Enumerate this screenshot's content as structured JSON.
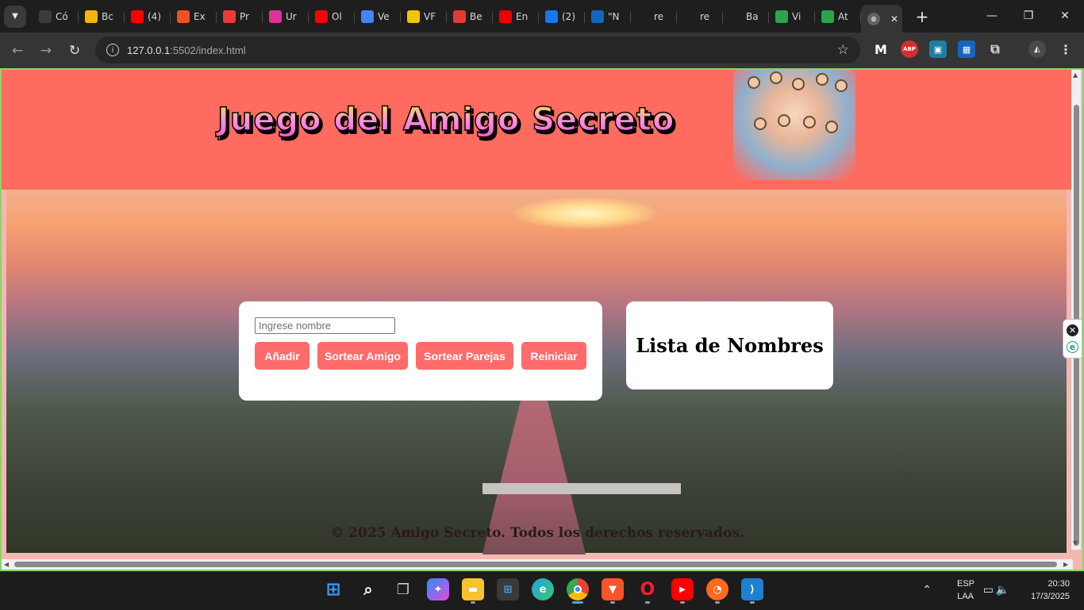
{
  "browser": {
    "tabs": [
      {
        "label": "Có",
        "icon": "document-icon",
        "color": "#3b3b3b"
      },
      {
        "label": "Bc",
        "icon": "drive-icon",
        "color": "#f7b500"
      },
      {
        "label": "(4)",
        "icon": "youtube-icon",
        "color": "#ff0000"
      },
      {
        "label": "Ex",
        "icon": "microsoft-icon",
        "color": "#f25022"
      },
      {
        "label": "Pr",
        "icon": "vivaldi-icon",
        "color": "#ef3939"
      },
      {
        "label": "Ur",
        "icon": "ef-icon",
        "color": "#e0309b"
      },
      {
        "label": "Ol",
        "icon": "youtube-icon",
        "color": "#ff0000"
      },
      {
        "label": "Ve",
        "icon": "google-icon",
        "color": "#4285f4"
      },
      {
        "label": "VF",
        "icon": "star-icon",
        "color": "#f5c400"
      },
      {
        "label": "Be",
        "icon": "c-icon",
        "color": "#e53935"
      },
      {
        "label": "En",
        "icon": "santander-icon",
        "color": "#ec0000"
      },
      {
        "label": "(2)",
        "icon": "facebook-icon",
        "color": "#1877f2"
      },
      {
        "label": "\"N",
        "icon": "g-icon",
        "color": "#1565c0"
      },
      {
        "label": "re",
        "icon": "github-icon",
        "color": "#1e1e1e"
      },
      {
        "label": "re",
        "icon": "github-icon",
        "color": "#1e1e1e"
      },
      {
        "label": "Ba",
        "icon": "postman-icon",
        "color": "#1e1e1e"
      },
      {
        "label": "Vi",
        "icon": "px-icon",
        "color": "#2ca44b"
      },
      {
        "label": "At",
        "icon": "px-icon",
        "color": "#2ca44b"
      }
    ],
    "active_tab_icon": "globe-icon",
    "url_host": "127.0.0.1",
    "url_rest": ":5502/index.html",
    "extensions": [
      "M",
      "ABP",
      "▣",
      "▦",
      "⧉"
    ]
  },
  "page": {
    "title": "Juego del Amigo Secreto",
    "input_placeholder": "Ingrese nombre",
    "buttons": {
      "add": "Añadir",
      "draw_friend": "Sortear Amigo",
      "draw_pairs": "Sortear Parejas",
      "reset": "Reiniciar"
    },
    "list_title": "Lista de Nombres",
    "footer": "© 2025 Amigo Secreto. Todos los derechos reservados."
  },
  "taskbar": {
    "language": "ESP",
    "layout": "LAA",
    "time": "20:30",
    "date": "17/3/2025"
  },
  "colors": {
    "header_bg": "#ff6b5e",
    "button_bg": "#ff6b6b",
    "title_fill": "#ff5ad0"
  }
}
